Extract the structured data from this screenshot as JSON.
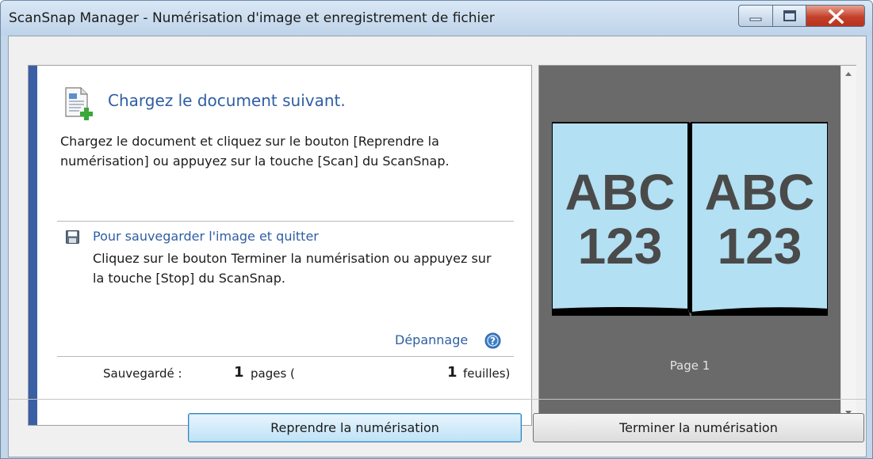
{
  "window": {
    "title": "ScanSnap Manager - Numérisation d'image et enregistrement de fichier",
    "controls": [
      "minimize-icon",
      "maximize-icon",
      "close-icon"
    ]
  },
  "instructions": {
    "heading": "Chargez le document suivant.",
    "body": "Chargez le document et cliquez sur le bouton [Reprendre la numérisation] ou appuyez sur la touche [Scan] du ScanSnap."
  },
  "save_section": {
    "heading": "Pour sauvegarder l'image et quitter",
    "body": "Cliquez sur le bouton Terminer la numérisation ou appuyez sur la touche [Stop] du ScanSnap."
  },
  "troubleshoot": {
    "label": "Dépannage"
  },
  "status": {
    "label": "Sauvegardé :",
    "pages_count": "1",
    "pages_unit": "pages (",
    "sheets_count": "1",
    "sheets_unit": "feuilles)"
  },
  "preview": {
    "page_label": "Page 1",
    "left_page": [
      "ABC",
      "123"
    ],
    "right_page": [
      "ABC",
      "123"
    ]
  },
  "buttons": {
    "resume": "Reprendre la numérisation",
    "finish": "Terminer la numérisation"
  },
  "colors": {
    "accent_blue": "#2f5ea3",
    "sidebar_bar": "#3a5fa5",
    "preview_bg": "#6a6a6a",
    "page_fill": "#b3e0f2",
    "page_text": "#4a4a4a"
  }
}
